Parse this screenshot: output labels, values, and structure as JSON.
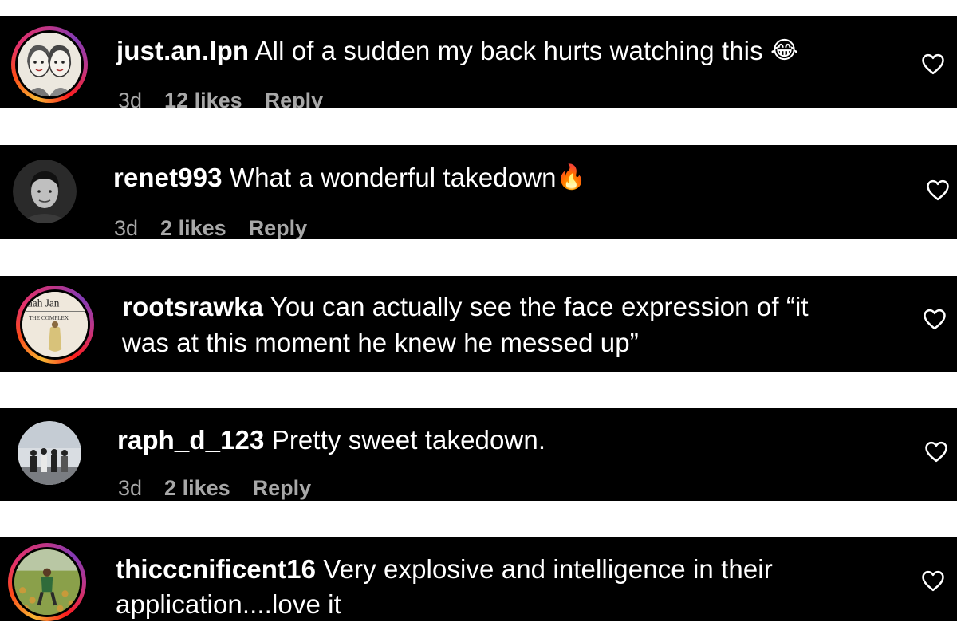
{
  "comments": [
    {
      "username": "just.an.lpn",
      "text": "All of a sudden my back hurts watching this",
      "emoji": "😂",
      "time": "3d",
      "likes": "12 likes",
      "reply": "Reply",
      "avatar_story_ring": true
    },
    {
      "username": "renet993",
      "text": "What a wonderful takedown",
      "emoji": "🔥",
      "time": "3d",
      "likes": "2 likes",
      "reply": "Reply",
      "avatar_story_ring": false
    },
    {
      "username": "rootsrawka",
      "text_line1": "You can actually see the face expression of “it",
      "text_line2": "was at this moment he knew he messed up”",
      "avatar_story_ring": true,
      "avatar_text": [
        "nah Jan",
        "THE COMPLEX"
      ]
    },
    {
      "username": "raph_d_123",
      "text": "Pretty sweet takedown.",
      "time": "3d",
      "likes": "2 likes",
      "reply": "Reply",
      "avatar_story_ring": false
    },
    {
      "username": "thicccnificent16",
      "text_line1": "Very explosive and intelligence in their",
      "text_line2": "application....love it",
      "avatar_story_ring": true
    }
  ],
  "icons": {
    "like": "heart-outline-icon"
  },
  "colors": {
    "background": "#000000",
    "text": "#ffffff",
    "meta_text": "#a8a8a8",
    "gap": "#ffffff"
  }
}
